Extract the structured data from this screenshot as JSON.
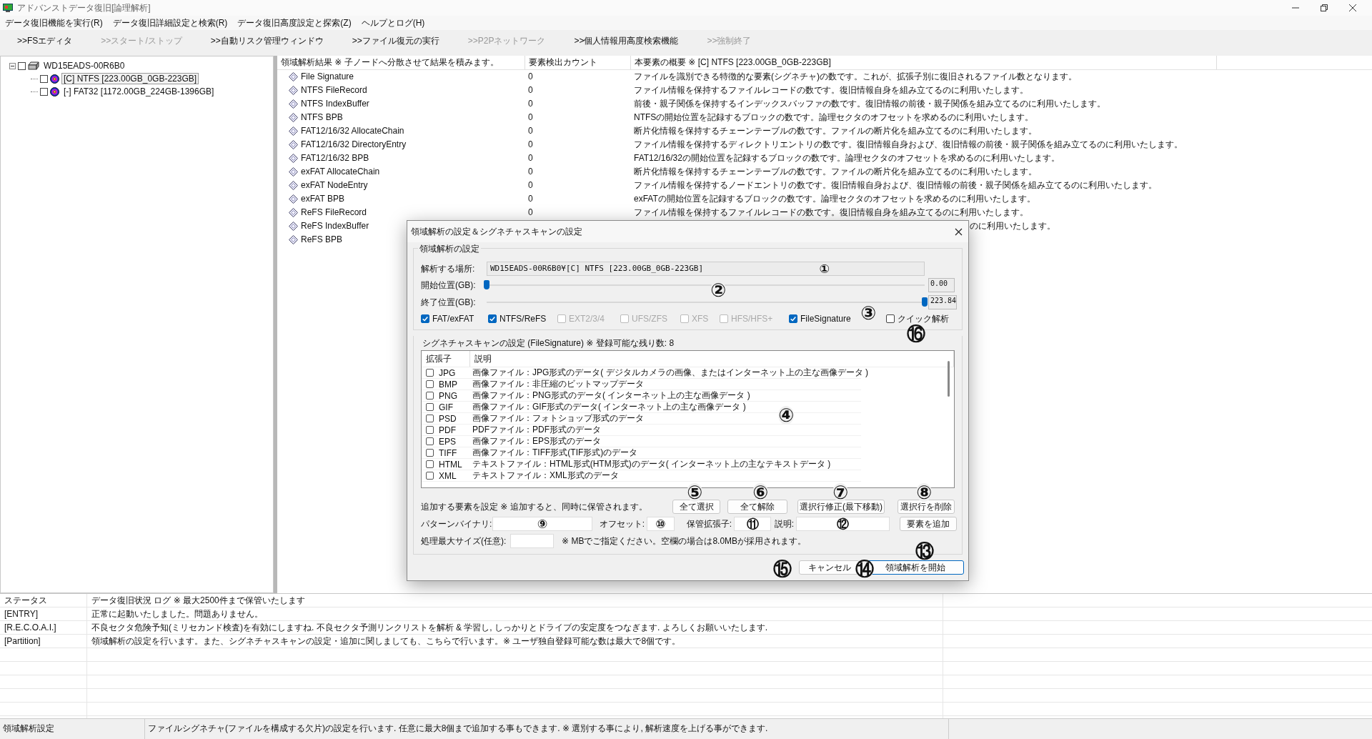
{
  "window": {
    "title": "アドバンストデータ復旧[論理解析]"
  },
  "menu": [
    "データ復旧機能を実行(R)",
    "データ復旧詳細設定と検索(R)",
    "データ復旧高度設定と探索(Z)",
    "ヘルプとログ(H)"
  ],
  "toolbar": [
    {
      "label": ">>FSエディタ",
      "disabled": false
    },
    {
      "label": ">>スタート/ストップ",
      "disabled": true
    },
    {
      "label": ">>自動リスク管理ウィンドウ",
      "disabled": false
    },
    {
      "label": ">>ファイル復元の実行",
      "disabled": false
    },
    {
      "label": ">>P2Pネットワーク",
      "disabled": true
    },
    {
      "label": ">>個人情報用高度検索機能",
      "disabled": false
    },
    {
      "label": ">>強制終了",
      "disabled": true
    }
  ],
  "tree": [
    {
      "label": "WD15EADS-00R6B0",
      "kind": "drive",
      "checked": false,
      "selected": false,
      "expanded": true,
      "children": [
        {
          "label": "[C] NTFS [223.00GB_0GB-223GB]",
          "kind": "partition",
          "checked": false,
          "selected": true
        },
        {
          "label": "[-] FAT32 [1172.00GB_224GB-1396GB]",
          "kind": "partition",
          "checked": false,
          "selected": false
        }
      ]
    }
  ],
  "results": {
    "columns": [
      "領域解析結果 ※ 子ノードへ分散させて結果を積みます。",
      "要素検出カウント",
      "本要素の概要 ※ [C] NTFS [223.00GB_0GB-223GB]"
    ],
    "rows": [
      {
        "name": "File Signature",
        "count": "0",
        "description": "ファイルを識別できる特徴的な要素(シグネチャ)の数です。これが、拡張子別に復旧されるファイル数となります。"
      },
      {
        "name": "NTFS FileRecord",
        "count": "0",
        "description": "ファイル情報を保持するファイルレコードの数です。復旧情報自身を組み立てるのに利用いたします。"
      },
      {
        "name": "NTFS IndexBuffer",
        "count": "0",
        "description": "前後・親子関係を保持するインデックスバッファの数です。復旧情報の前後・親子関係を組み立てるのに利用いたします。"
      },
      {
        "name": "NTFS BPB",
        "count": "0",
        "description": "NTFSの開始位置を記録するブロックの数です。論理セクタのオフセットを求めるのに利用いたします。"
      },
      {
        "name": "FAT12/16/32 AllocateChain",
        "count": "0",
        "description": "断片化情報を保持するチェーンテーブルの数です。ファイルの断片化を組み立てるのに利用いたします。"
      },
      {
        "name": "FAT12/16/32 DirectoryEntry",
        "count": "0",
        "description": "ファイル情報を保持するディレクトリエントリの数です。復旧情報自身および、復旧情報の前後・親子関係を組み立てるのに利用いたします。"
      },
      {
        "name": "FAT12/16/32 BPB",
        "count": "0",
        "description": "FAT12/16/32の開始位置を記録するブロックの数です。論理セクタのオフセットを求めるのに利用いたします。"
      },
      {
        "name": "exFAT AllocateChain",
        "count": "0",
        "description": "断片化情報を保持するチェーンテーブルの数です。ファイルの断片化を組み立てるのに利用いたします。"
      },
      {
        "name": "exFAT NodeEntry",
        "count": "0",
        "description": "ファイル情報を保持するノードエントリの数です。復旧情報自身および、復旧情報の前後・親子関係を組み立てるのに利用いたします。"
      },
      {
        "name": "exFAT BPB",
        "count": "0",
        "description": "exFATの開始位置を記録するブロックの数です。論理セクタのオフセットを求めるのに利用いたします。"
      },
      {
        "name": "ReFS FileRecord",
        "count": "0",
        "description": "ファイル情報を保持するファイルレコードの数です。復旧情報自身を組み立てるのに利用いたします。"
      },
      {
        "name": "ReFS IndexBuffer",
        "kind": "covered",
        "description": "のに利用いたします。"
      },
      {
        "name": "ReFS BPB",
        "kind": "covered"
      }
    ]
  },
  "dialog": {
    "title": "領域解析の設定＆シグネチャスキャンの設定",
    "section_title": "領域解析の設定",
    "location": {
      "label": "解析する場所:",
      "value": "WD15EADS-00R6B0¥[C] NTFS [223.00GB_0GB-223GB]"
    },
    "sliders": [
      {
        "label": "開始位置(GB):",
        "level": 0,
        "value": "0.00"
      },
      {
        "label": "終了位置(GB):",
        "level": 1,
        "value": "223.84"
      }
    ],
    "filesystems": [
      {
        "label": "FAT/exFAT",
        "checked": true,
        "disabled": false
      },
      {
        "label": "NTFS/ReFS",
        "checked": true,
        "disabled": false
      },
      {
        "label": "EXT2/3/4",
        "checked": false,
        "disabled": true
      },
      {
        "label": "UFS/ZFS",
        "checked": false,
        "disabled": true
      },
      {
        "label": "XFS",
        "checked": false,
        "disabled": true
      },
      {
        "label": "HFS/HFS+",
        "checked": false,
        "disabled": true
      },
      {
        "label": "FileSignature",
        "checked": true,
        "disabled": false
      },
      {
        "label": "クイック解析",
        "checked": false,
        "disabled": false
      }
    ],
    "signature_title": "シグネチャスキャンの設定 (FileSignature) ※ 登録可能な残り数: 8",
    "signature_table": {
      "columns": [
        "拡張子",
        "説明"
      ],
      "rows": [
        {
          "extension": "JPG",
          "checked": false,
          "description": "画像ファイル：JPG形式のデータ( デジタルカメラの画像、またはインターネット上の主な画像データ )"
        },
        {
          "extension": "BMP",
          "checked": false,
          "description": "画像ファイル：非圧縮のビットマップデータ"
        },
        {
          "extension": "PNG",
          "checked": false,
          "description": "画像ファイル：PNG形式のデータ( インターネット上の主な画像データ )"
        },
        {
          "extension": "GIF",
          "checked": false,
          "description": "画像ファイル：GIF形式のデータ( インターネット上の主な画像データ )"
        },
        {
          "extension": "PSD",
          "checked": false,
          "description": "画像ファイル：フォトショップ形式のデータ"
        },
        {
          "extension": "PDF",
          "checked": false,
          "description": "PDFファイル：PDF形式のデータ"
        },
        {
          "extension": "EPS",
          "checked": false,
          "description": "画像ファイル：EPS形式のデータ"
        },
        {
          "extension": "TIFF",
          "checked": false,
          "description": "画像ファイル：TIFF形式(TIF形式)のデータ"
        },
        {
          "extension": "HTML",
          "checked": false,
          "description": "テキストファイル：HTML形式(HTM形式)のデータ( インターネット上の主なテキストデータ )"
        },
        {
          "extension": "XML",
          "checked": false,
          "description": "テキストファイル：XML形式のデータ"
        }
      ]
    },
    "add_title": "追加する要素を設定 ※ 追加すると、同時に保管されます。",
    "list_buttons": [
      "全て選択",
      "全て解除",
      "選択行修正(最下移動)",
      "選択行を削除"
    ],
    "fields": [
      {
        "label": "パターンバイナリ:"
      },
      {
        "label": "オフセット:"
      },
      {
        "label": "保管拡張子:"
      },
      {
        "label": "説明:"
      }
    ],
    "add_button": "要素を追加",
    "max_size": {
      "label": "処理最大サイズ(任意):",
      "note": "※ MBでご指定ください。空欄の場合は8.0MBが採用されます。"
    },
    "buttons": [
      {
        "label": "キャンセル",
        "default": false
      },
      {
        "label": "領域解析を開始",
        "default": true
      }
    ]
  },
  "callouts": [
    "①",
    "②",
    "③",
    "④",
    "⑤",
    "⑥",
    "⑦",
    "⑧",
    "⑨",
    "⑩",
    "⑪",
    "⑫",
    "⑬",
    "⑭",
    "⑮",
    "⑯"
  ],
  "log": {
    "columns": [
      "ステータス",
      "データ復旧状況 ログ ※ 最大2500件まで保管いたします"
    ],
    "rows": [
      {
        "status": "[ENTRY]",
        "message": "正常に起動いたしました。問題ありません。"
      },
      {
        "status": "[R.E.C.O.A.I.]",
        "message": "不良セクタ危険予知(ミリセカンド検査)を有効にしますね. 不良セクタ予測リンクリストを解析 & 学習し, しっかりとドライブの安定度をつなぎます. よろしくお願いいたします."
      },
      {
        "status": "[Partition]",
        "message": "領域解析の設定を行います。また、シグネチャスキャンの設定・追加に関しましても、こちらで行います。※ ユーザ独自登録可能な数は最大で8個です。"
      }
    ]
  },
  "status_bar": [
    "領域解析設定",
    "ファイルシグネチャ(ファイルを構成する欠片)の設定を行います. 任意に最大8個まで追加する事もできます. ※ 選別する事により, 解析速度を上げる事ができます."
  ]
}
